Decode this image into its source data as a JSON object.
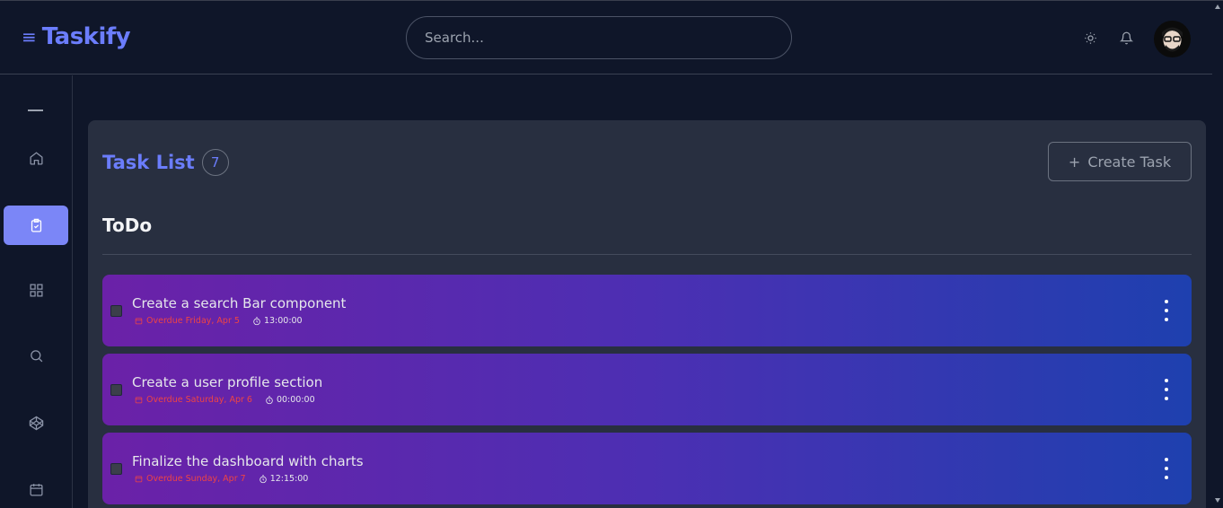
{
  "header": {
    "brand": "Taskify",
    "search_placeholder": "Search...",
    "icons": [
      "menu-icon",
      "sun-icon",
      "bell-icon",
      "avatar"
    ]
  },
  "sidebar": {
    "items": [
      {
        "icon": "minus-icon"
      },
      {
        "icon": "home-icon"
      },
      {
        "icon": "clipboard-check-icon",
        "active": true
      },
      {
        "icon": "grid-icon"
      },
      {
        "icon": "search-icon"
      },
      {
        "icon": "codepen-icon"
      },
      {
        "icon": "calendar-icon"
      }
    ]
  },
  "main": {
    "title": "Task List",
    "count": "7",
    "create_button": "Create Task",
    "section": "ToDo",
    "tasks": [
      {
        "name": "Create a search Bar component",
        "due": "Overdue Friday, Apr 5",
        "time": "13:00:00"
      },
      {
        "name": "Create a user profile section",
        "due": "Overdue Saturday, Apr 6",
        "time": "00:00:00"
      },
      {
        "name": "Finalize the dashboard with charts",
        "due": "Overdue Sunday, Apr 7",
        "time": "12:15:00"
      }
    ]
  },
  "colors": {
    "accent": "#6b7dfc",
    "background": "#0f1629",
    "panel": "#282f40",
    "overdue": "#ef4444",
    "active_nav": "#7b86f7"
  }
}
